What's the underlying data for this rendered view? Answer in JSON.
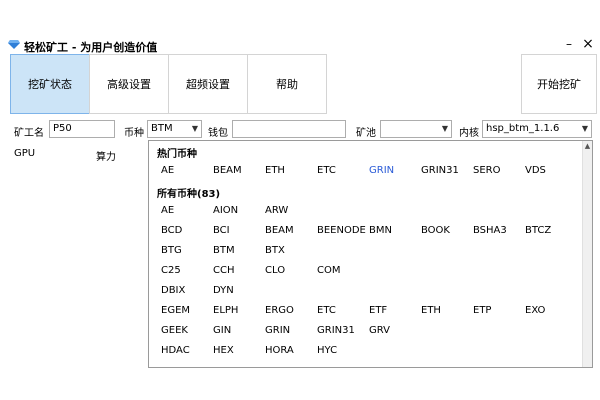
{
  "window": {
    "title": "轻松矿工 - 为用户创造价值",
    "min_symbol": "–",
    "close_symbol": "×"
  },
  "toolbar": {
    "mine_status": "挖矿状态",
    "advanced": "高级设置",
    "overclock": "超频设置",
    "help": "帮助",
    "start": "开始挖矿"
  },
  "fields": {
    "miner_label": "矿工名",
    "miner_value": "P50",
    "coin_label": "币种",
    "coin_value": "BTM",
    "wallet_label": "钱包",
    "wallet_value": "",
    "pool_label": "矿池",
    "pool_value": "",
    "kernel_label": "内核",
    "kernel_value": "hsp_btm_1.1.6"
  },
  "list": {
    "col_gpu": "GPU",
    "col_hash": "算力"
  },
  "dropdown": {
    "hot_title": "热门币种",
    "hot_coins": [
      "AE",
      "BEAM",
      "ETH",
      "ETC",
      "GRIN",
      "GRIN31",
      "SERO",
      "VDS"
    ],
    "highlight": "GRIN",
    "all_title": "所有币种(83)",
    "all_rows": [
      [
        "AE",
        "AION",
        "ARW"
      ],
      [
        "BCD",
        "BCI",
        "BEAM",
        "BEENODE",
        "BMN",
        "BOOK",
        "BSHA3",
        "BTCZ"
      ],
      [
        "BTG",
        "BTM",
        "BTX"
      ],
      [
        "C25",
        "CCH",
        "CLO",
        "COM"
      ],
      [
        "DBIX",
        "DYN"
      ],
      [
        "EGEM",
        "ELPH",
        "ERGO",
        "ETC",
        "ETF",
        "ETH",
        "ETP",
        "EXO"
      ],
      [
        "GEEK",
        "GIN",
        "GRIN",
        "GRIN31",
        "GRV"
      ],
      [
        "HDAC",
        "HEX",
        "HORA",
        "HYC"
      ]
    ]
  },
  "colors": {
    "active_tab": "#cce4f7",
    "highlight": "#2a5bd7",
    "logo": "#2f7fd8"
  }
}
